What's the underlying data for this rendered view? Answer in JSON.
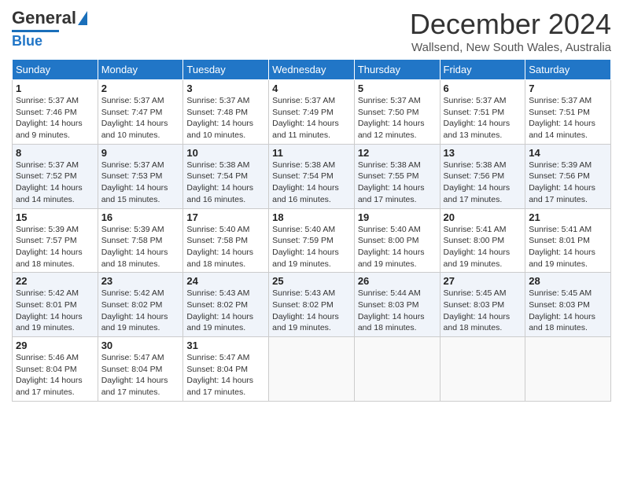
{
  "header": {
    "logo": "General Blue",
    "title": "December 2024",
    "location": "Wallsend, New South Wales, Australia"
  },
  "weekdays": [
    "Sunday",
    "Monday",
    "Tuesday",
    "Wednesday",
    "Thursday",
    "Friday",
    "Saturday"
  ],
  "weeks": [
    [
      {
        "day": 1,
        "rise": "5:37 AM",
        "set": "7:46 PM",
        "daylight": "14 hours and 9 minutes."
      },
      {
        "day": 2,
        "rise": "5:37 AM",
        "set": "7:47 PM",
        "daylight": "14 hours and 10 minutes."
      },
      {
        "day": 3,
        "rise": "5:37 AM",
        "set": "7:48 PM",
        "daylight": "14 hours and 10 minutes."
      },
      {
        "day": 4,
        "rise": "5:37 AM",
        "set": "7:49 PM",
        "daylight": "14 hours and 11 minutes."
      },
      {
        "day": 5,
        "rise": "5:37 AM",
        "set": "7:50 PM",
        "daylight": "14 hours and 12 minutes."
      },
      {
        "day": 6,
        "rise": "5:37 AM",
        "set": "7:51 PM",
        "daylight": "14 hours and 13 minutes."
      },
      {
        "day": 7,
        "rise": "5:37 AM",
        "set": "7:51 PM",
        "daylight": "14 hours and 14 minutes."
      }
    ],
    [
      {
        "day": 8,
        "rise": "5:37 AM",
        "set": "7:52 PM",
        "daylight": "14 hours and 14 minutes."
      },
      {
        "day": 9,
        "rise": "5:37 AM",
        "set": "7:53 PM",
        "daylight": "14 hours and 15 minutes."
      },
      {
        "day": 10,
        "rise": "5:38 AM",
        "set": "7:54 PM",
        "daylight": "14 hours and 16 minutes."
      },
      {
        "day": 11,
        "rise": "5:38 AM",
        "set": "7:54 PM",
        "daylight": "14 hours and 16 minutes."
      },
      {
        "day": 12,
        "rise": "5:38 AM",
        "set": "7:55 PM",
        "daylight": "14 hours and 17 minutes."
      },
      {
        "day": 13,
        "rise": "5:38 AM",
        "set": "7:56 PM",
        "daylight": "14 hours and 17 minutes."
      },
      {
        "day": 14,
        "rise": "5:39 AM",
        "set": "7:56 PM",
        "daylight": "14 hours and 17 minutes."
      }
    ],
    [
      {
        "day": 15,
        "rise": "5:39 AM",
        "set": "7:57 PM",
        "daylight": "14 hours and 18 minutes."
      },
      {
        "day": 16,
        "rise": "5:39 AM",
        "set": "7:58 PM",
        "daylight": "14 hours and 18 minutes."
      },
      {
        "day": 17,
        "rise": "5:40 AM",
        "set": "7:58 PM",
        "daylight": "14 hours and 18 minutes."
      },
      {
        "day": 18,
        "rise": "5:40 AM",
        "set": "7:59 PM",
        "daylight": "14 hours and 19 minutes."
      },
      {
        "day": 19,
        "rise": "5:40 AM",
        "set": "8:00 PM",
        "daylight": "14 hours and 19 minutes."
      },
      {
        "day": 20,
        "rise": "5:41 AM",
        "set": "8:00 PM",
        "daylight": "14 hours and 19 minutes."
      },
      {
        "day": 21,
        "rise": "5:41 AM",
        "set": "8:01 PM",
        "daylight": "14 hours and 19 minutes."
      }
    ],
    [
      {
        "day": 22,
        "rise": "5:42 AM",
        "set": "8:01 PM",
        "daylight": "14 hours and 19 minutes."
      },
      {
        "day": 23,
        "rise": "5:42 AM",
        "set": "8:02 PM",
        "daylight": "14 hours and 19 minutes."
      },
      {
        "day": 24,
        "rise": "5:43 AM",
        "set": "8:02 PM",
        "daylight": "14 hours and 19 minutes."
      },
      {
        "day": 25,
        "rise": "5:43 AM",
        "set": "8:02 PM",
        "daylight": "14 hours and 19 minutes."
      },
      {
        "day": 26,
        "rise": "5:44 AM",
        "set": "8:03 PM",
        "daylight": "14 hours and 18 minutes."
      },
      {
        "day": 27,
        "rise": "5:45 AM",
        "set": "8:03 PM",
        "daylight": "14 hours and 18 minutes."
      },
      {
        "day": 28,
        "rise": "5:45 AM",
        "set": "8:03 PM",
        "daylight": "14 hours and 18 minutes."
      }
    ],
    [
      {
        "day": 29,
        "rise": "5:46 AM",
        "set": "8:04 PM",
        "daylight": "14 hours and 17 minutes."
      },
      {
        "day": 30,
        "rise": "5:47 AM",
        "set": "8:04 PM",
        "daylight": "14 hours and 17 minutes."
      },
      {
        "day": 31,
        "rise": "5:47 AM",
        "set": "8:04 PM",
        "daylight": "14 hours and 17 minutes."
      },
      null,
      null,
      null,
      null
    ]
  ]
}
